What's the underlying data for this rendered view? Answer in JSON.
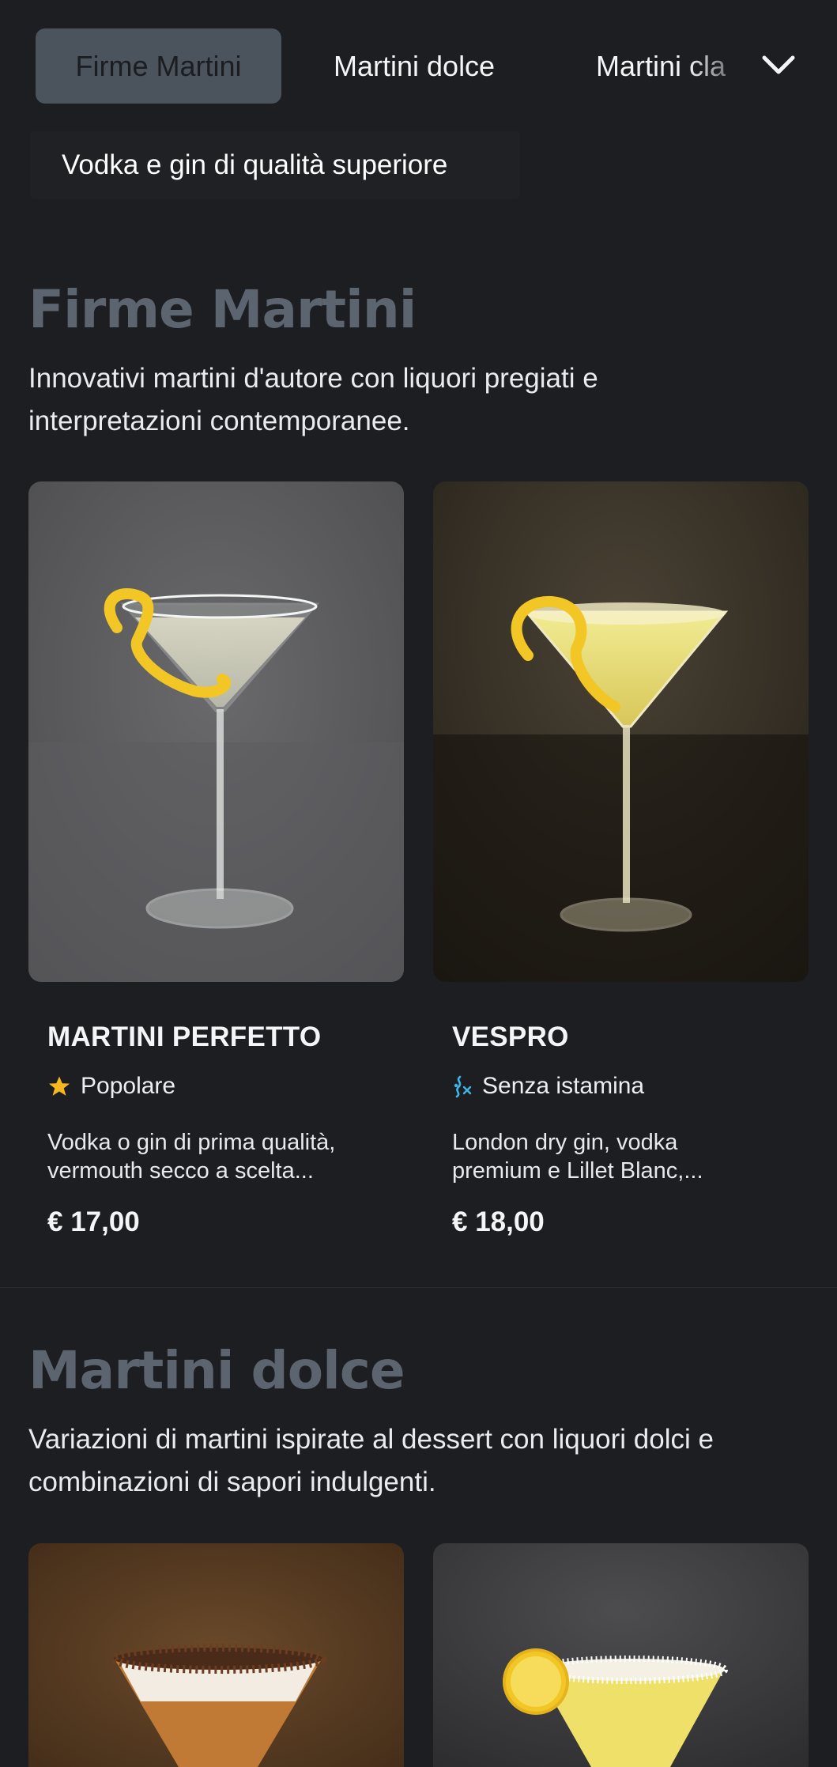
{
  "tabs": [
    {
      "label": "Firme Martini",
      "active": true
    },
    {
      "label": "Martini dolce",
      "active": false
    },
    {
      "label": "Martini cla",
      "active": false
    }
  ],
  "subtab": {
    "label": "Vodka e gin di qualità superiore"
  },
  "sections": [
    {
      "title": "Firme Martini",
      "description_lines": [
        "Innovativi martini d'autore con liquori pregiati e",
        "interpretazioni contemporanee."
      ],
      "items": [
        {
          "name": "MARTINI PERFETTO",
          "tag": {
            "label": "Popolare",
            "icon": "star-icon",
            "color": "#f5b820"
          },
          "description_lines": [
            "Vodka o gin di prima qualità,",
            "vermouth secco a scelta..."
          ],
          "price": "€ 17,00"
        },
        {
          "name": "VESPRO",
          "tag": {
            "label": "Senza istamina",
            "icon": "histamine-free-icon",
            "color": "#3fb6e8"
          },
          "description_lines": [
            "London dry gin, vodka",
            "premium e Lillet Blanc,..."
          ],
          "price": "€ 18,00"
        }
      ]
    },
    {
      "title": "Martini dolce",
      "description_lines": [
        "Variazioni di martini ispirate al dessert con liquori dolci e",
        "combinazioni di sapori indulgenti."
      ]
    }
  ],
  "colors": {
    "background": "#1c1e21",
    "active_tab": "#4b535d",
    "section_title": "#5c6470",
    "popular_star": "#f5b820",
    "histamine_icon": "#3fb6e8"
  }
}
